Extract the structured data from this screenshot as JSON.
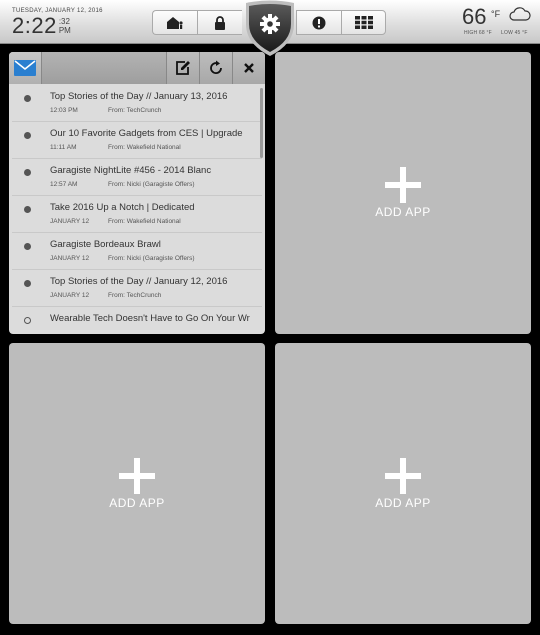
{
  "clock": {
    "date": "TUESDAY, JANUARY 12, 2016",
    "hours_minutes": "2:22",
    "seconds": ":32",
    "ampm": "PM"
  },
  "nav": {
    "items": [
      {
        "icon": "home-person-icon",
        "label": "Home"
      },
      {
        "icon": "lock-icon",
        "label": "Security"
      },
      {
        "icon": "gear-icon",
        "label": "Settings"
      },
      {
        "icon": "alert-icon",
        "label": "Alerts"
      },
      {
        "icon": "grid-icon",
        "label": "Apps"
      }
    ]
  },
  "weather": {
    "temp": "66",
    "unit": "°F",
    "high": "HIGH 68 °F",
    "low": "LOW 45 °F",
    "icon": "cloud-icon"
  },
  "mail": {
    "header_icon": "envelope-icon",
    "actions": [
      {
        "icon": "compose-icon",
        "label": "Compose"
      },
      {
        "icon": "refresh-icon",
        "label": "Refresh"
      },
      {
        "icon": "close-icon",
        "label": "Close"
      }
    ],
    "items": [
      {
        "subject": "Top Stories of the Day // January 13, 2016",
        "time": "12:03 PM",
        "from": "From: TechCrunch",
        "read": false
      },
      {
        "subject": "Our 10 Favorite Gadgets from CES | Upgrade",
        "time": "11:11 AM",
        "from": "From: Wakefield National",
        "read": false
      },
      {
        "subject": "Garagiste NightLite #456 - 2014 Blanc",
        "time": "12:57 AM",
        "from": "From: Nicki (Garagiste Offers)",
        "read": false
      },
      {
        "subject": "Take 2016 Up a Notch | Dedicated",
        "time": "JANUARY 12",
        "from": "From: Wakefield National",
        "read": false
      },
      {
        "subject": "Garagiste Bordeaux Brawl",
        "time": "JANUARY 12",
        "from": "From: Nicki (Garagiste Offers)",
        "read": false
      },
      {
        "subject": "Top Stories of the Day // January 12, 2016",
        "time": "JANUARY 12",
        "from": "From: TechCrunch",
        "read": false
      },
      {
        "subject": "Wearable Tech Doesn't Have to Go On Your Wr",
        "time": "",
        "from": "",
        "read": true
      }
    ]
  },
  "panels": {
    "add_app_label": "ADD APP"
  },
  "colors": {
    "accent_blue": "#2a7fd0",
    "panel_gray": "#bcbcbc"
  }
}
